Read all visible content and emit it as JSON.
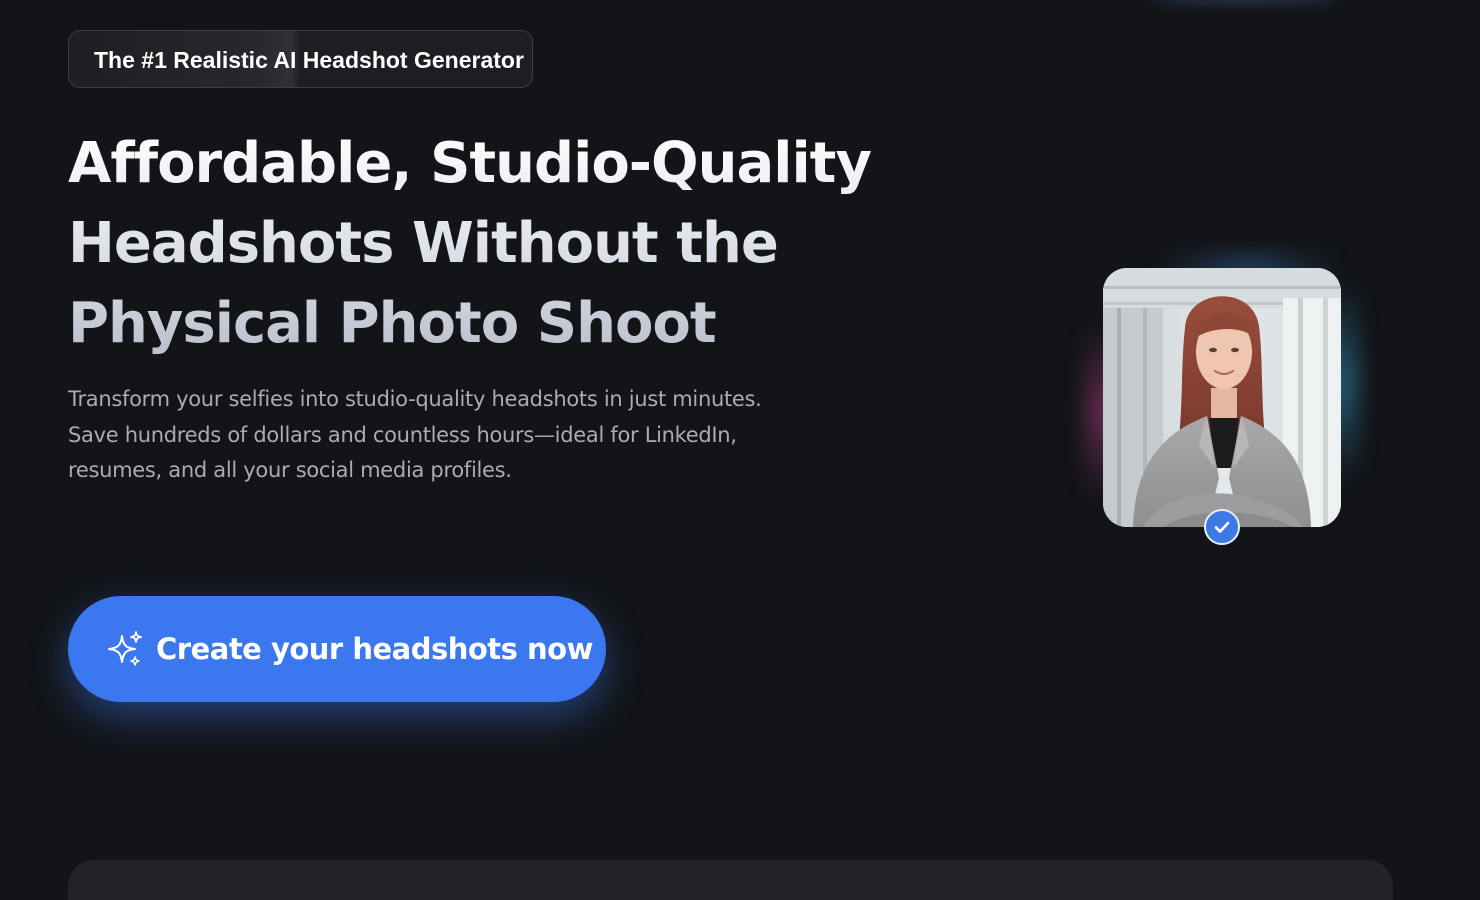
{
  "badge": {
    "label": "The #1 Realistic AI Headshot Generator"
  },
  "hero": {
    "headline_lines": [
      "Affordable, Studio-Quality",
      "Headshots Without the",
      "Physical Photo Shoot"
    ],
    "subtext_lines": [
      "Transform your selfies into studio-quality headshots in just minutes.",
      "Save hundreds of dollars and countless hours—ideal for LinkedIn,",
      "resumes, and all your social media profiles."
    ]
  },
  "cta": {
    "label": "Create your headshots now",
    "icon": "sparkles-icon"
  },
  "sample": {
    "image": "headshot-photo",
    "badge_icon": "verified-check-icon"
  },
  "colors": {
    "background": "#121417",
    "accent": "#3b78f0",
    "text_primary": "#ffffff",
    "text_muted": "#a9acb3"
  }
}
